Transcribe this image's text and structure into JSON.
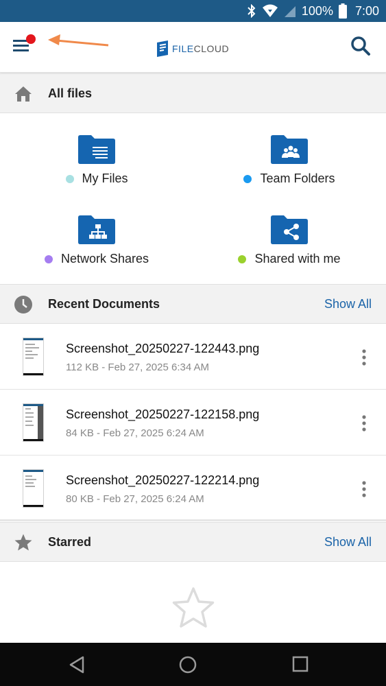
{
  "status_bar": {
    "battery": "100%",
    "time": "7:00",
    "icons": [
      "bluetooth-icon",
      "wifi-icon",
      "signal-icon",
      "battery-icon"
    ]
  },
  "app_bar": {
    "logo_prefix": "FILE",
    "logo_suffix": "CLOUD",
    "menu_icon": "hamburger-menu-icon",
    "search_icon": "search-icon",
    "badge_color": "#e3161c",
    "annotation_arrow_color": "#f0894a"
  },
  "all_files": {
    "title": "All files",
    "icon": "home-icon",
    "items": [
      {
        "label": "My Files",
        "icon": "document-folder-icon",
        "dot_color": "#a8e0e2"
      },
      {
        "label": "Team Folders",
        "icon": "team-folder-icon",
        "dot_color": "#1a9af0"
      },
      {
        "label": "Network Shares",
        "icon": "network-folder-icon",
        "dot_color": "#a57df0"
      },
      {
        "label": "Shared with me",
        "icon": "shared-folder-icon",
        "dot_color": "#9ad12d"
      }
    ]
  },
  "recent": {
    "title": "Recent Documents",
    "show_all": "Show All",
    "icon": "clock-icon",
    "files": [
      {
        "name": "Screenshot_20250227-122443.png",
        "meta": "112 KB - Feb 27, 2025 6:34 AM"
      },
      {
        "name": "Screenshot_20250227-122158.png",
        "meta": "84 KB - Feb 27, 2025 6:24 AM"
      },
      {
        "name": "Screenshot_20250227-122214.png",
        "meta": "80 KB - Feb 27, 2025 6:24 AM"
      }
    ]
  },
  "starred": {
    "title": "Starred",
    "show_all": "Show All",
    "icon": "star-icon"
  },
  "colors": {
    "status_bar": "#1e5a87",
    "accent": "#1a63a8",
    "folder": "#1565b0"
  }
}
